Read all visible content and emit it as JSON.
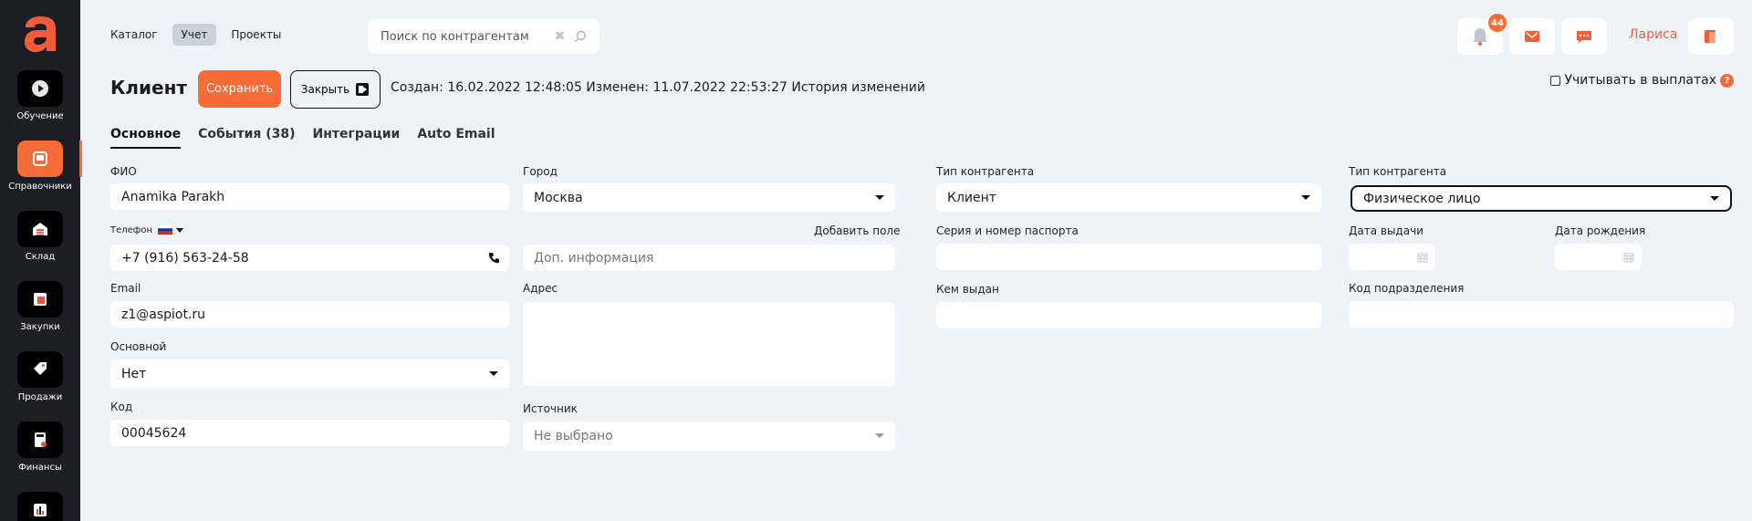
{
  "app": {
    "logo_letter": "a"
  },
  "sidebar": {
    "items": [
      {
        "label": "Обучение",
        "icon": "play-icon"
      },
      {
        "label": "Справочники",
        "icon": "book-icon",
        "active": true
      },
      {
        "label": "Склад",
        "icon": "warehouse-icon"
      },
      {
        "label": "Закупки",
        "icon": "cart-icon"
      },
      {
        "label": "Продажи",
        "icon": "tag-icon"
      },
      {
        "label": "Финансы",
        "icon": "calculator-icon"
      },
      {
        "label": "",
        "icon": "chart-icon"
      }
    ]
  },
  "topnav": {
    "items": [
      {
        "label": "Каталог"
      },
      {
        "label": "Учет",
        "active": true
      },
      {
        "label": "Проекты"
      }
    ]
  },
  "search": {
    "placeholder": "Поиск по контрагентам"
  },
  "notifications": {
    "count": "44"
  },
  "user": {
    "name": "Лариса"
  },
  "header": {
    "title": "Клиент",
    "save_label": "Сохранить",
    "close_label": "Закрыть",
    "meta": "Создан: 16.02.2022 12:48:05 Изменен: 11.07.2022 22:53:27 История изменений",
    "payout_label": "Учитывать в выплатах",
    "help": "?"
  },
  "tabs": [
    {
      "label": "Основное",
      "active": true
    },
    {
      "label": "События (38)"
    },
    {
      "label": "Интеграции"
    },
    {
      "label": "Auto Email"
    }
  ],
  "form": {
    "fio": {
      "label": "ФИО",
      "value": "Anamika Parakh"
    },
    "phone": {
      "label": "Телефон",
      "value": "+7 (916) 563-24-58"
    },
    "email": {
      "label": "Email",
      "value": "z1@aspiot.ru"
    },
    "main": {
      "label": "Основной",
      "value": "Нет"
    },
    "code": {
      "label": "Код",
      "value": "00045624"
    },
    "city": {
      "label": "Город",
      "value": "Москва"
    },
    "add_field": {
      "label": "Добавить поле"
    },
    "extra": {
      "placeholder": "Доп. информация"
    },
    "address": {
      "label": "Адрес",
      "value": ""
    },
    "source": {
      "label": "Источник",
      "value": "Не выбрано"
    },
    "type1": {
      "label": "Тип контрагента",
      "value": "Клиент"
    },
    "passport": {
      "label": "Серия и номер паспорта",
      "value": ""
    },
    "issued_by": {
      "label": "Кем выдан",
      "value": ""
    },
    "type2": {
      "label": "Тип контрагента",
      "value": "Физическое лицо"
    },
    "issue_date": {
      "label": "Дата выдачи",
      "value": ""
    },
    "birth_date": {
      "label": "Дата рождения",
      "value": ""
    },
    "dept_code": {
      "label": "Код подразделения",
      "value": ""
    }
  },
  "colors": {
    "accent": "#f76b37",
    "sidebar": "#1d1d25",
    "background": "#eef3fa"
  }
}
